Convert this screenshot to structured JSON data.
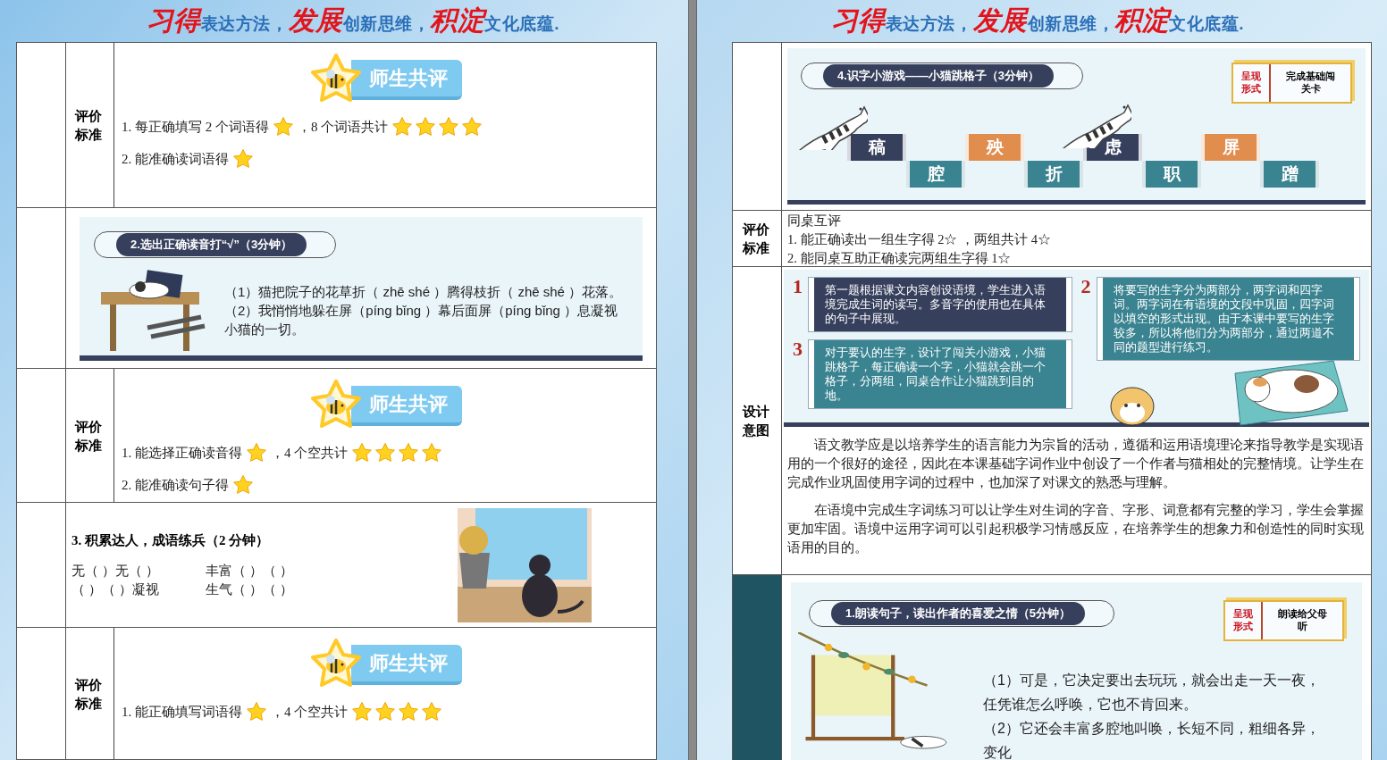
{
  "left_page": {
    "banner": [
      {
        "text": "习得",
        "kind": "accent"
      },
      {
        "text": "表达方法，",
        "kind": "plain"
      },
      {
        "text": "发展",
        "kind": "accent"
      },
      {
        "text": "创新思维，",
        "kind": "plain"
      },
      {
        "text": "积淀",
        "kind": "accent"
      },
      {
        "text": "文化底蕴.",
        "kind": "plain"
      }
    ],
    "rows": [
      {
        "kind": "evaluation",
        "label": "评价标准",
        "badge": "师生共评",
        "lines": [
          [
            {
              "kind": "text",
              "text": "1.  每正确填写 2 个词语得"
            },
            {
              "kind": "icon"
            },
            {
              "kind": "text",
              "text": "，8 个词语共计"
            },
            {
              "kind": "rating",
              "stars": 4
            }
          ],
          [
            {
              "kind": "text",
              "text": "2.  能准确读词语得"
            },
            {
              "kind": "icon"
            }
          ]
        ]
      },
      {
        "kind": "exercise",
        "title": "2.选出正确读音打“√”（3分钟）",
        "paragraphs": [
          "（1）猫把院子的花草折（ zhē  shé ）腾得枝折（ zhē  shé ）花落。",
          "（2）我悄悄地躲在屏（píng  bǐng ）幕后面屏（píng  bǐng ）息凝视小猫的一切。"
        ]
      },
      {
        "kind": "evaluation",
        "label": "评价标准",
        "badge": "师生共评",
        "lines": [
          [
            {
              "kind": "text",
              "text": "1. 能选择正确读音得"
            },
            {
              "kind": "icon"
            },
            {
              "kind": "text",
              "text": "，4 个空共计"
            },
            {
              "kind": "rating",
              "stars": 4
            }
          ],
          [
            {
              "kind": "text",
              "text": "2. 能准确读句子得"
            },
            {
              "kind": "icon"
            }
          ]
        ]
      },
      {
        "kind": "idioms",
        "title": "3. 积累达人，成语练兵（2 分钟）",
        "cells": [
          "无（ ）无（ ）",
          "丰富（ ）（ ）",
          "（ ）（ ）凝视",
          "生气（ ）（ ）"
        ]
      },
      {
        "kind": "evaluation",
        "label": "评价标准",
        "badge": "师生共评",
        "lines": [
          [
            {
              "kind": "text",
              "text": "1. 能正确填写词语得"
            },
            {
              "kind": "icon"
            },
            {
              "kind": "text",
              "text": "，4 个空共计"
            },
            {
              "kind": "rating",
              "stars": 4
            }
          ]
        ]
      }
    ]
  },
  "right_page": {
    "banner": [
      {
        "text": "习得",
        "kind": "accent"
      },
      {
        "text": "表达方法，",
        "kind": "plain"
      },
      {
        "text": "发展",
        "kind": "accent"
      },
      {
        "text": "创新思维，",
        "kind": "plain"
      },
      {
        "text": "积淀",
        "kind": "accent"
      },
      {
        "text": "文化底蕴.",
        "kind": "plain"
      }
    ],
    "rows": [
      {
        "kind": "game",
        "title": "4.识字小游戏——小猫跳格子（3分钟）",
        "format_label": "呈现形式",
        "format_value": "完成基础闯关卡",
        "tiles": [
          {
            "text": "稿",
            "kind": "high",
            "color": "#363f5c"
          },
          {
            "text": "腔",
            "kind": "low",
            "color": "#3a8390"
          },
          {
            "text": "殃",
            "kind": "high",
            "color": "#e08d4e"
          },
          {
            "text": "折",
            "kind": "low",
            "color": "#3a8390"
          },
          {
            "text": "虑",
            "kind": "high",
            "color": "#363f5c"
          },
          {
            "text": "职",
            "kind": "low",
            "color": "#3a8390"
          },
          {
            "text": "屏",
            "kind": "high",
            "color": "#e08d4e"
          },
          {
            "text": "蹭",
            "kind": "low",
            "color": "#3a8390"
          }
        ]
      },
      {
        "kind": "criteria",
        "label": "评价标准",
        "lines": [
          "同桌互评",
          "1. 能正确读出一组生字得 2☆ ，两组共计 4☆",
          "2. 能同桌互助正确读完两组生字得 1☆"
        ]
      },
      {
        "kind": "design",
        "label": "设计意图",
        "notes": [
          {
            "number": "1",
            "text": "第一题根据课文内容创设语境，学生进入语境完成生词的读写。多音字的使用也在具体的句子中展现。",
            "color": "#363f5c"
          },
          {
            "number": "2",
            "text": "将要写的生字分为两部分，两字词和四字词。两字词在有语境的文段中巩固，四字词以填空的形式出现。由于本课中要写的生字较多，所以将他们分为两部分，通过两道不同的题型进行练习。",
            "color": "#3a8390"
          },
          {
            "number": "3",
            "text": "对于要认的生字，设计了闯关小游戏，小猫跳格子，每正确读一个字，小猫就会跳一个格子，分两组，同桌合作让小猫跳到目的地。",
            "color": "#3a8390"
          }
        ],
        "paragraphs": [
          "语文教学应是以培养学生的语言能力为宗旨的活动，遵循和运用语境理论来指导教学是实现语用的一个很好的途径，因此在本课基础字词作业中创设了一个作者与猫相处的完整情境。让学生在完成作业巩固使用字词的过程中，也加深了对课文的熟悉与理解。",
          "在语境中完成生字词练习可以让学生对生词的字音、字形、词意都有完整的学习，学生会掌握更加牢固。语境中运用字词可以引起积极学习情感反应，在培养学生的想象力和创造性的同时实现语用的目的。"
        ]
      },
      {
        "kind": "reading",
        "title": "1.朗读句子，读出作者的喜爱之情（5分钟）",
        "format_label": "呈现形式",
        "format_value": "朗读给父母听",
        "paragraphs": [
          "（1）可是，它决定要出去玩玩，就会出走一天一夜，任凭谁怎么呼唤，它也不肯回来。",
          "（2）它还会丰富多腔地叫唤，长短不同，粗细各异，变化"
        ]
      }
    ]
  }
}
